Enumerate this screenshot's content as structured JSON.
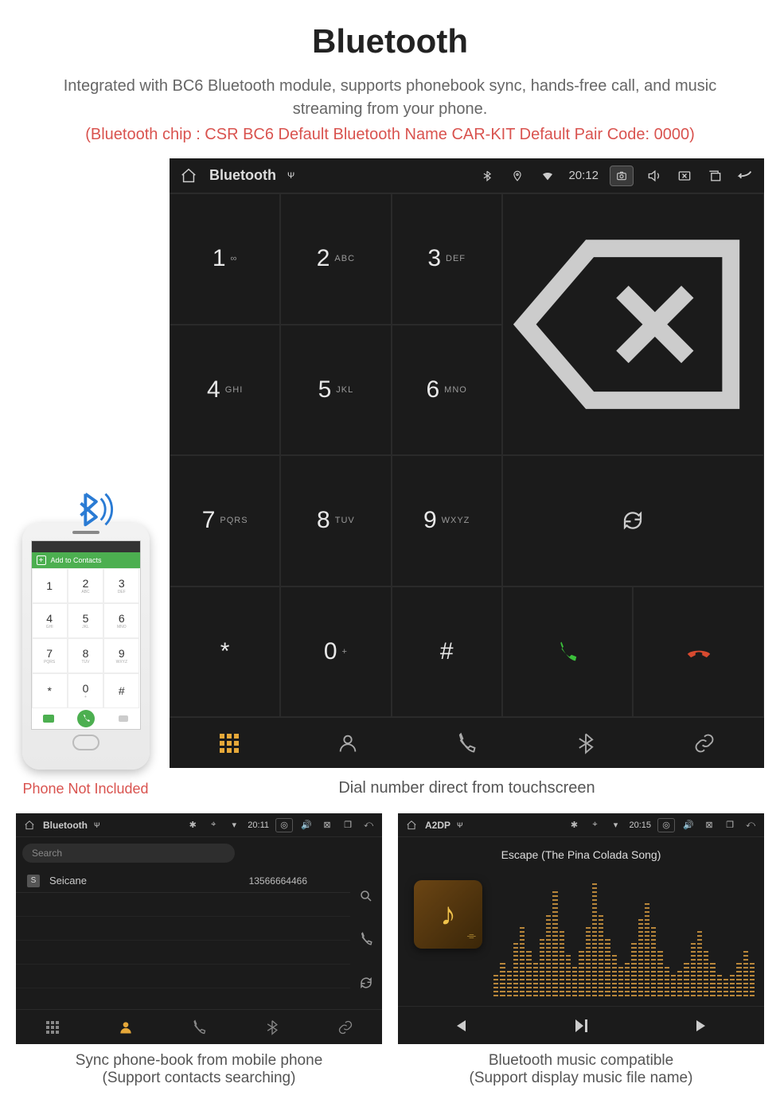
{
  "header": {
    "title": "Bluetooth",
    "subtitle": "Integrated with BC6 Bluetooth module, supports phonebook sync, hands-free call, and music streaming from your phone.",
    "specs": "(Bluetooth chip : CSR BC6     Default Bluetooth Name CAR-KIT     Default Pair Code: 0000)"
  },
  "phone": {
    "addContacts": "Add to Contacts",
    "caption": "Phone Not Included",
    "keys": [
      {
        "n": "1",
        "l": ""
      },
      {
        "n": "2",
        "l": "ABC"
      },
      {
        "n": "3",
        "l": "DEF"
      },
      {
        "n": "4",
        "l": "GHI"
      },
      {
        "n": "5",
        "l": "JKL"
      },
      {
        "n": "6",
        "l": "MNO"
      },
      {
        "n": "7",
        "l": "PQRS"
      },
      {
        "n": "8",
        "l": "TUV"
      },
      {
        "n": "9",
        "l": "WXYZ"
      },
      {
        "n": "*",
        "l": ""
      },
      {
        "n": "0",
        "l": "+"
      },
      {
        "n": "#",
        "l": ""
      }
    ]
  },
  "dialer": {
    "statusTitle": "Bluetooth",
    "time": "20:12",
    "keys": [
      {
        "d": "1",
        "t": "∞"
      },
      {
        "d": "2",
        "t": "ABC"
      },
      {
        "d": "3",
        "t": "DEF"
      },
      {
        "d": "4",
        "t": "GHI"
      },
      {
        "d": "5",
        "t": "JKL"
      },
      {
        "d": "6",
        "t": "MNO"
      },
      {
        "d": "7",
        "t": "PQRS"
      },
      {
        "d": "8",
        "t": "TUV"
      },
      {
        "d": "9",
        "t": "WXYZ"
      },
      {
        "d": "*",
        "t": ""
      },
      {
        "d": "0",
        "t": "+"
      },
      {
        "d": "#",
        "t": ""
      }
    ],
    "caption": "Dial number direct from touchscreen"
  },
  "contacts": {
    "statusTitle": "Bluetooth",
    "time": "20:11",
    "searchPlaceholder": "Search",
    "entry": {
      "badge": "S",
      "name": "Seicane",
      "number": "13566664466"
    },
    "caption1": "Sync phone-book from mobile phone",
    "caption2": "(Support contacts searching)"
  },
  "music": {
    "statusTitle": "A2DP",
    "time": "20:15",
    "song": "Escape (The Pina Colada Song)",
    "caption1": "Bluetooth music compatible",
    "caption2": "(Support display music file name)"
  }
}
